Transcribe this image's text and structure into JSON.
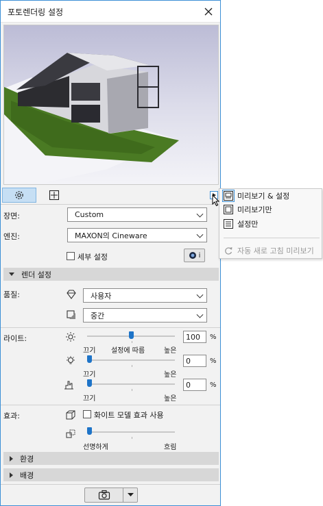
{
  "window": {
    "title": "포토렌더링 설정"
  },
  "scene": {
    "label": "장면:",
    "value": "Custom"
  },
  "engine": {
    "label": "엔진:",
    "value": "MAXON의 Cineware"
  },
  "detail": {
    "label": "세부 설정",
    "checked": false
  },
  "render_info_label": "i",
  "render_section": {
    "title": "렌더 설정"
  },
  "quality": {
    "label": "품질:",
    "value1": "사용자",
    "value2": "중간"
  },
  "lights": {
    "label": "라이트:",
    "slider1": {
      "value": "100",
      "unit": "%",
      "left_label": "끄기",
      "middle_label": "설정에 따름",
      "right_label": "높은",
      "level": 0.5
    },
    "slider2": {
      "value": "0",
      "unit": "%",
      "left_label": "끄기",
      "right_label": "높은",
      "level": 0.0
    },
    "slider3": {
      "value": "0",
      "unit": "%",
      "left_label": "끄기",
      "right_label": "높은",
      "level": 0.0
    }
  },
  "effects": {
    "label": "효과:",
    "white_model_label": "화이트 모델 효과 사용",
    "white_model_checked": false,
    "sharp_label": "선명하게",
    "blur_label": "흐림",
    "level": 0.0
  },
  "environment_section": {
    "title": "환경"
  },
  "background_section": {
    "title": "배경"
  },
  "popup_menu": {
    "items": [
      {
        "label": "미리보기 & 설정",
        "selected": true
      },
      {
        "label": "미리보기만",
        "selected": false
      },
      {
        "label": "설정만",
        "selected": false
      }
    ],
    "auto_refresh_label": "자동 새로 고침 미리보기"
  },
  "colors": {
    "accent": "#1e74c8",
    "selection": "#c6dff4",
    "border": "#3b8fd6"
  }
}
